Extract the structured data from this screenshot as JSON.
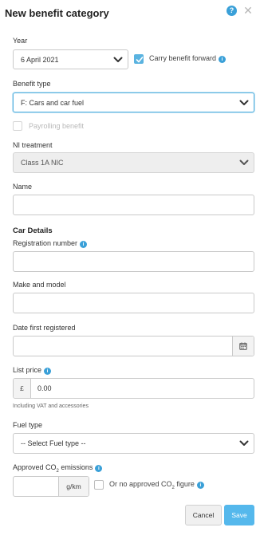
{
  "dialog": {
    "title": "New benefit category",
    "help_glyph": "?",
    "close_glyph": "✕"
  },
  "form": {
    "year": {
      "label": "Year",
      "value": "6 April 2021"
    },
    "carry_forward": {
      "label": "Carry benefit forward",
      "checked": true
    },
    "benefit_type": {
      "label": "Benefit type",
      "value": "F: Cars and car fuel"
    },
    "payrolling": {
      "label": "Payrolling benefit",
      "checked": false,
      "disabled": true
    },
    "ni_treatment": {
      "label": "NI treatment",
      "value": "Class 1A NIC",
      "disabled": true
    },
    "name": {
      "label": "Name",
      "value": ""
    }
  },
  "car_details": {
    "heading": "Car Details",
    "registration": {
      "label": "Registration number",
      "value": ""
    },
    "make_model": {
      "label": "Make and model",
      "value": ""
    },
    "date_registered": {
      "label": "Date first registered",
      "value": ""
    },
    "list_price": {
      "label": "List price",
      "currency": "£",
      "value": "0.00",
      "note": "Including VAT and accessories"
    },
    "fuel_type": {
      "label": "Fuel type",
      "value": "-- Select Fuel type --"
    },
    "co2": {
      "label_prefix": "Approved CO",
      "label_sub": "2",
      "label_suffix": " emissions",
      "value": "",
      "unit": "g/km",
      "no_figure_prefix": "Or no approved CO",
      "no_figure_sub": "2",
      "no_figure_suffix": " figure",
      "no_figure_checked": false
    }
  },
  "actions": {
    "cancel": "Cancel",
    "save": "Save"
  },
  "colors": {
    "accent": "#3aa0d8",
    "save_button": "#55b8ec",
    "focus_border": "#5ab3e0"
  },
  "icons": {
    "info": "i",
    "calendar": "calendar-icon",
    "chevron": "chevron-down-icon"
  }
}
